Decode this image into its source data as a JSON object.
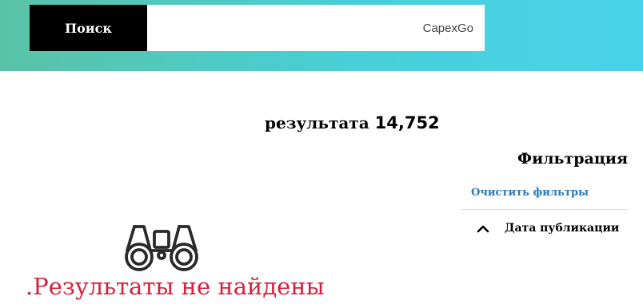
{
  "header": {
    "search_button_label": "Поиск",
    "search_value": "CapexGo",
    "gradient_colors": [
      "#5ac3a6",
      "#49d3ea"
    ]
  },
  "results": {
    "label": "результата",
    "count": "14,752"
  },
  "filters": {
    "title": "Фильтрация",
    "clear_label": "Очистить фильтры",
    "facets": [
      {
        "label": "Дата публикации",
        "icon": "chevron-up-icon",
        "expanded": true
      }
    ]
  },
  "empty_state": {
    "icon": "binoculars-icon",
    "message": ".Результаты не найдены",
    "message_color": "#d81f3a"
  },
  "accent": {
    "link_color": "#2a7ab8"
  }
}
